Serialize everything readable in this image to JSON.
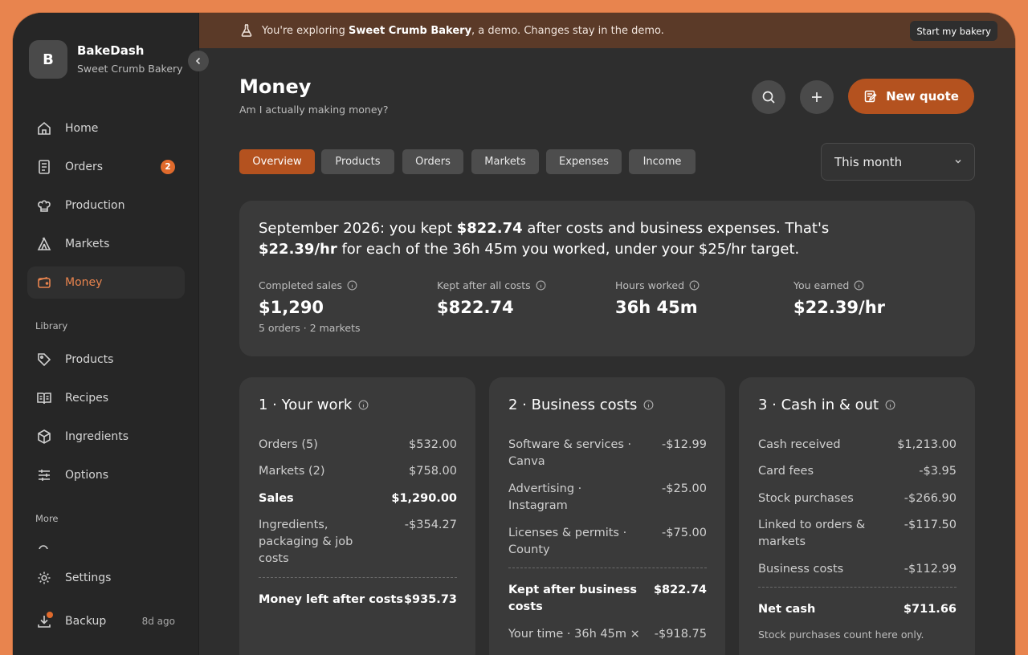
{
  "brand": {
    "initial": "B",
    "name": "BakeDash",
    "sub": "Sweet Crumb Bakery"
  },
  "nav": {
    "home": "Home",
    "orders": "Orders",
    "orders_badge": "2",
    "production": "Production",
    "markets": "Markets",
    "money": "Money",
    "library_label": "Library",
    "products": "Products",
    "recipes": "Recipes",
    "ingredients": "Ingredients",
    "options": "Options",
    "more_label": "More",
    "settings": "Settings",
    "backup": "Backup",
    "backup_ago": "8d ago"
  },
  "banner": {
    "prefix": "You're exploring ",
    "bakery": "Sweet Crumb Bakery",
    "suffix": ", a demo. Changes stay in the demo.",
    "start_button": "Start my bakery"
  },
  "header": {
    "title": "Money",
    "subtitle": "Am I actually making money?",
    "new_quote": "New quote"
  },
  "tabs": [
    "Overview",
    "Products",
    "Orders",
    "Markets",
    "Expenses",
    "Income"
  ],
  "period": "This month",
  "summary": {
    "line1_a": "September 2026: you kept ",
    "line1_b": "$822.74",
    "line1_c": " after costs and business expenses. That's",
    "line2_a": "$22.39/hr",
    "line2_b": " for each of the 36h 45m you worked, under your $25/hr target.",
    "stats": [
      {
        "label": "Completed sales",
        "value": "$1,290",
        "sub": "5 orders · 2 markets"
      },
      {
        "label": "Kept after all costs",
        "value": "$822.74",
        "sub": ""
      },
      {
        "label": "Hours worked",
        "value": "36h 45m",
        "sub": ""
      },
      {
        "label": "You earned",
        "value": "$22.39/hr",
        "sub": ""
      }
    ]
  },
  "work": {
    "title": "1 · Your work",
    "rows": [
      {
        "label": "Orders (5)",
        "value": "$532.00"
      },
      {
        "label": "Markets (2)",
        "value": "$758.00"
      },
      {
        "label": "Sales",
        "value": "$1,290.00"
      },
      {
        "label": "Ingredients, packaging & job costs",
        "value": "-$354.27"
      }
    ],
    "total": {
      "label": "Money left after costs",
      "value": "$935.73"
    }
  },
  "business": {
    "title": "2 · Business costs",
    "rows": [
      {
        "label": "Software & services · Canva",
        "value": "-$12.99"
      },
      {
        "label": "Advertising · Instagram",
        "value": "-$25.00"
      },
      {
        "label": "Licenses & permits · County",
        "value": "-$75.00"
      }
    ],
    "total": {
      "label": "Kept after business costs",
      "value": "$822.74"
    },
    "extra": {
      "label": "Your time · 36h 45m ×",
      "value": "-$918.75"
    }
  },
  "cash": {
    "title": "3 · Cash in & out",
    "rows": [
      {
        "label": "Cash received",
        "value": "$1,213.00"
      },
      {
        "label": "Card fees",
        "value": "-$3.95"
      },
      {
        "label": "Stock purchases",
        "value": "-$266.90"
      },
      {
        "label": "Linked to orders & markets",
        "value": "-$117.50"
      },
      {
        "label": "Business costs",
        "value": "-$112.99"
      }
    ],
    "total": {
      "label": "Net cash",
      "value": "$711.66"
    },
    "note": "Stock purchases count here only."
  },
  "colors": {
    "accent": "#e8844e",
    "accent_dark": "#b4521f",
    "banner": "#5b3a28"
  }
}
